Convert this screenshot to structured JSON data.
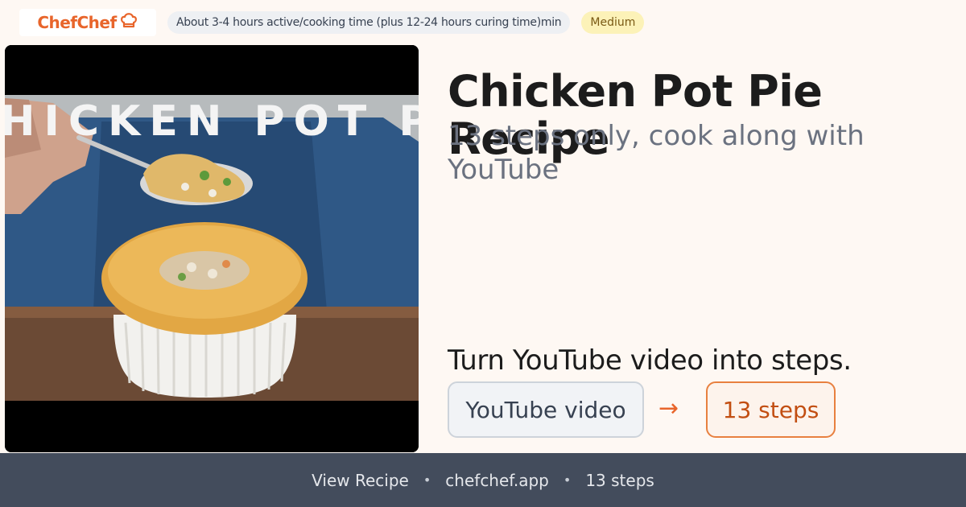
{
  "brand": {
    "name": "ChefChef",
    "color": "#e8652b"
  },
  "meta": {
    "time": "About 3-4 hours active/cooking time (plus 12-24 hours curing time)min",
    "difficulty": "Medium"
  },
  "video": {
    "overlay_text": "HICKEN POT PI",
    "icon": "chef-hat-icon"
  },
  "recipe": {
    "title": "Chicken Pot Pie Recipe",
    "subtitle": "13 steps only, cook along with YouTube"
  },
  "convert": {
    "heading": "Turn YouTube video into steps.",
    "source_label": "YouTube video",
    "arrow": "→",
    "target_label": "13 steps"
  },
  "footer": {
    "view_recipe": "View Recipe",
    "separator": "•",
    "domain": "chefchef.app",
    "steps": "13 steps"
  }
}
